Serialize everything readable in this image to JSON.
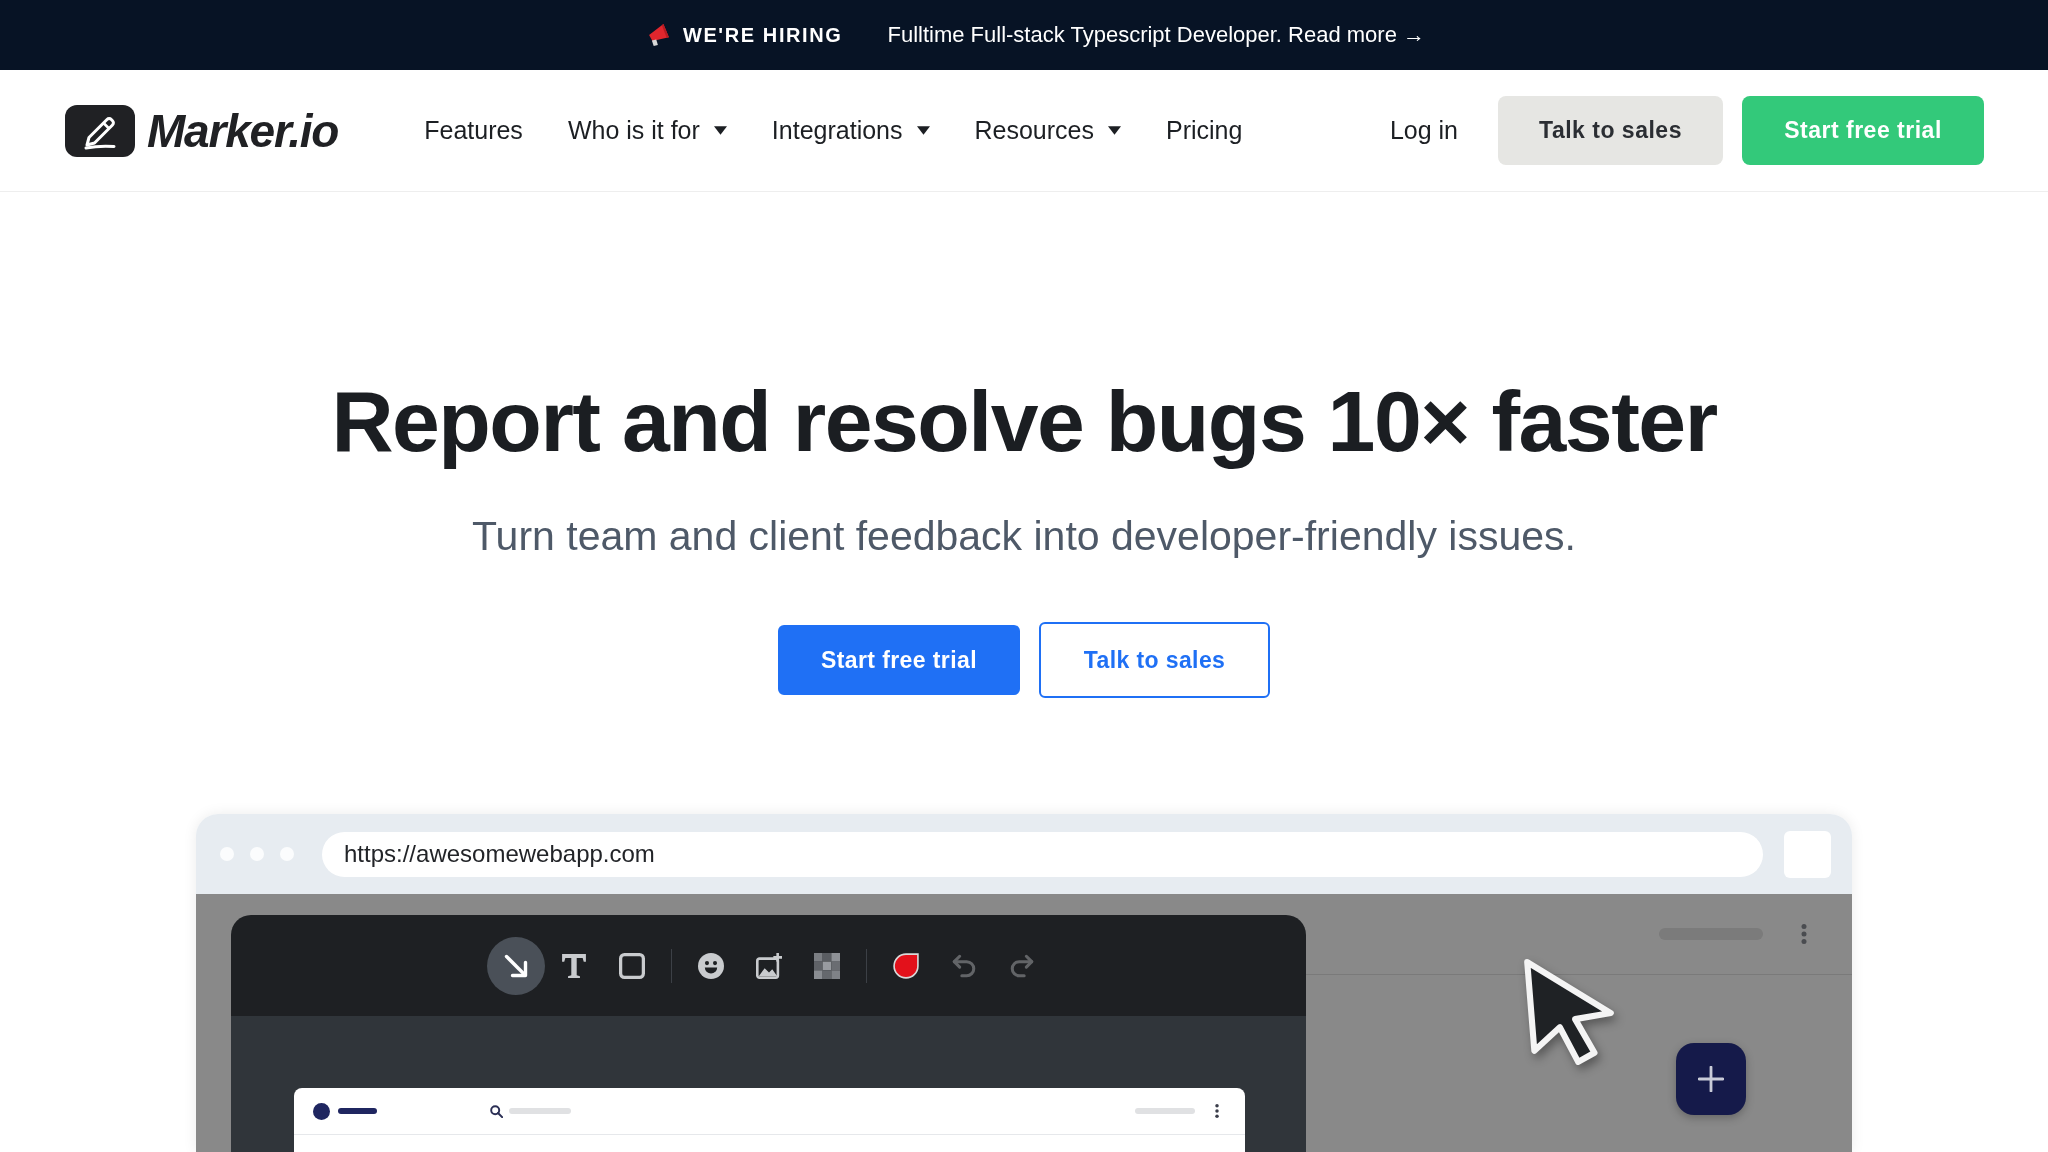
{
  "announcement": {
    "label": "WE'RE HIRING",
    "link": "Fulltime Full-stack Typescript Developer. Read more →"
  },
  "nav": {
    "logo": "Marker.io",
    "links": [
      {
        "label": "Features",
        "dropdown": false
      },
      {
        "label": "Who is it for",
        "dropdown": true
      },
      {
        "label": "Integrations",
        "dropdown": true
      },
      {
        "label": "Resources",
        "dropdown": true
      },
      {
        "label": "Pricing",
        "dropdown": false
      }
    ],
    "login": "Log in",
    "buttons": [
      {
        "label": "Talk to sales",
        "kind": "secondary"
      },
      {
        "label": "Start free trial",
        "kind": "primary"
      }
    ]
  },
  "hero": {
    "title": "Report and resolve bugs 10× faster",
    "subtitle": "Turn team and client feedback into developer-friendly issues.",
    "buttons": [
      {
        "label": "Start free trial",
        "kind": "primary"
      },
      {
        "label": "Talk to sales",
        "kind": "outline"
      }
    ]
  },
  "browser": {
    "url": "https://awesomewebapp.com",
    "tool_groups": [
      {
        "tools": [
          {
            "kind": "arrow",
            "selected": true,
            "disabled": false
          },
          {
            "kind": "text",
            "selected": false,
            "disabled": false
          },
          {
            "kind": "rectangle",
            "selected": false,
            "disabled": false
          }
        ]
      },
      {
        "tools": [
          {
            "kind": "emoji",
            "selected": false,
            "disabled": false
          },
          {
            "kind": "image",
            "selected": false,
            "disabled": false
          },
          {
            "kind": "blur",
            "selected": false,
            "disabled": false
          }
        ]
      },
      {
        "tools": [
          {
            "kind": "color",
            "selected": false,
            "disabled": false
          },
          {
            "kind": "undo",
            "selected": false,
            "disabled": true
          },
          {
            "kind": "redo",
            "selected": false,
            "disabled": true
          }
        ]
      }
    ]
  }
}
